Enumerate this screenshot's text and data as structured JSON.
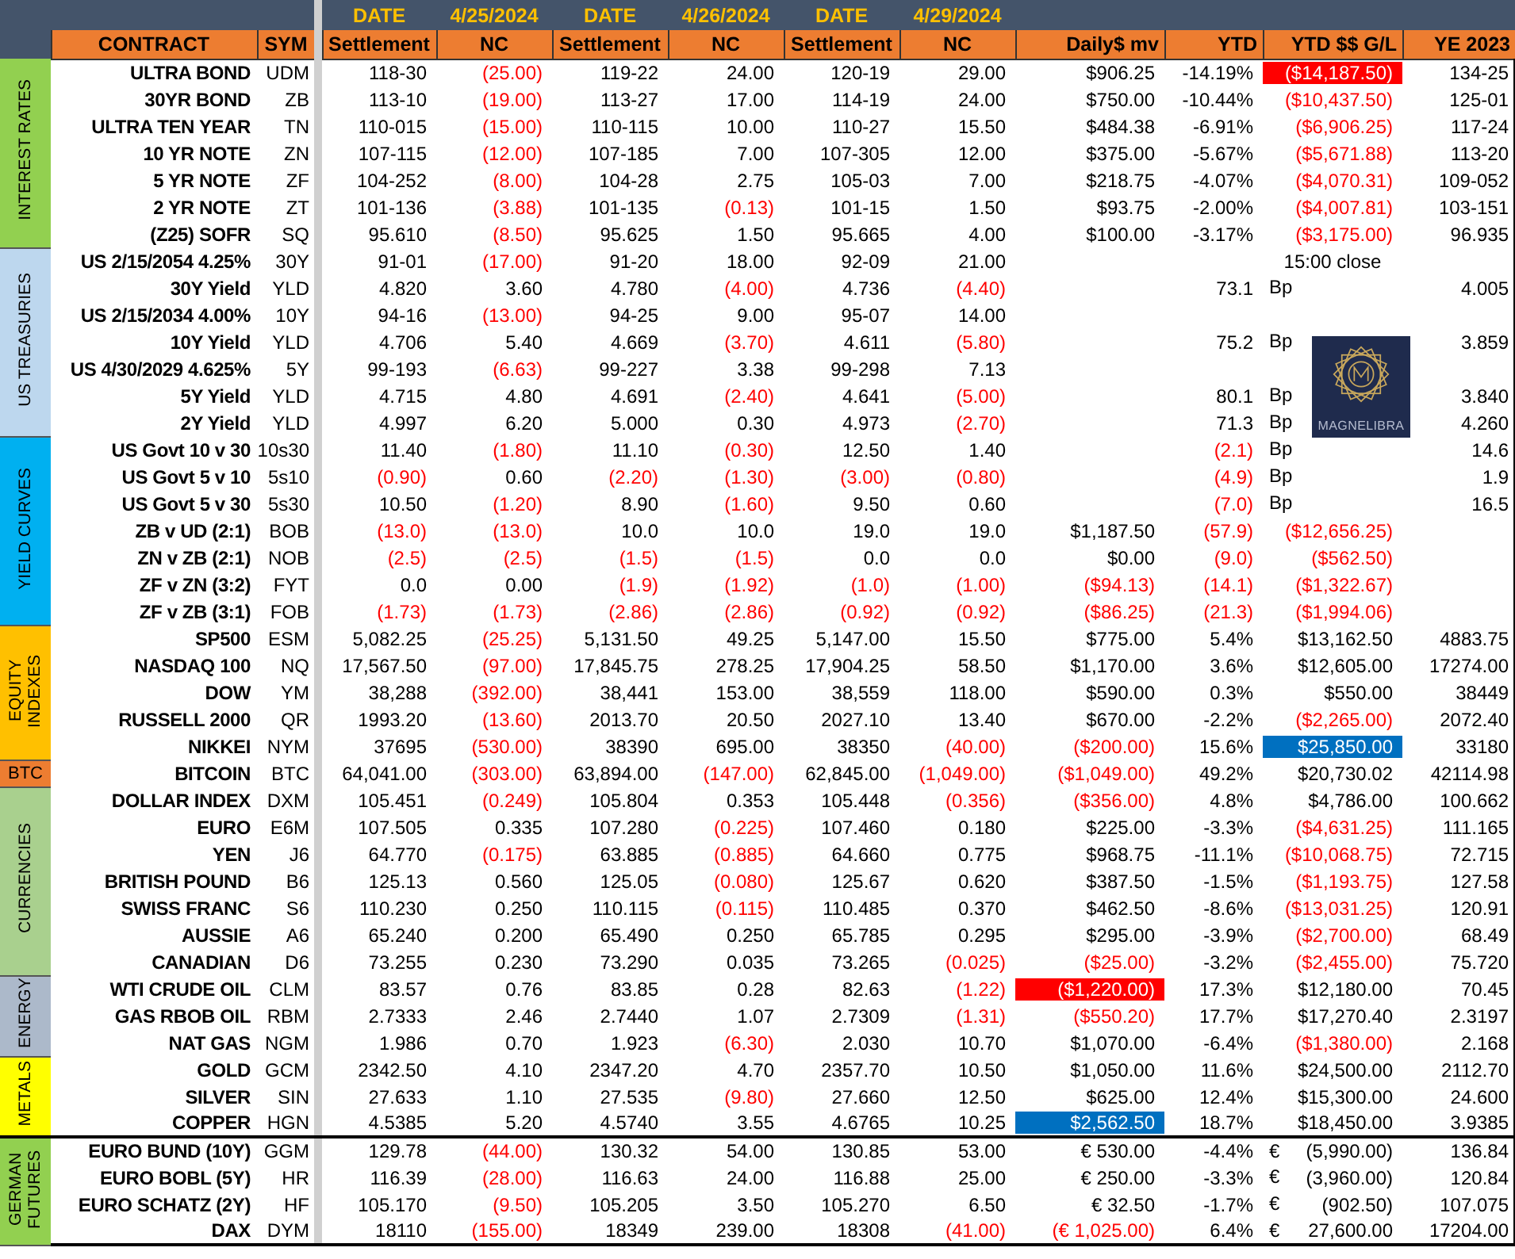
{
  "header": {
    "dates": [
      {
        "label": "DATE",
        "date": "4/25/2024"
      },
      {
        "label": "DATE",
        "date": "4/26/2024"
      },
      {
        "label": "DATE",
        "date": "4/29/2024"
      }
    ],
    "columns": [
      "CONTRACT",
      "SYM",
      "Settlement",
      "NC",
      "Settlement",
      "NC",
      "Settlement",
      "NC",
      "Daily$ mv",
      "YTD",
      "YTD $$ G/L",
      "YE 2023"
    ]
  },
  "logo": {
    "text": "MAGNELIBRA"
  },
  "sections": [
    {
      "label": "INTEREST RATES",
      "color": "#92d050",
      "rule_above": false,
      "rows": [
        {
          "name": "ULTRA BOND",
          "sym": "UDM",
          "s1": {
            "t": "118-30",
            "red": false
          },
          "nc1": {
            "t": "(25.00)",
            "red": true
          },
          "s2": {
            "t": "119-22",
            "red": false
          },
          "nc2": {
            "t": "24.00",
            "red": false
          },
          "s3": {
            "t": "120-19",
            "red": false
          },
          "nc3": {
            "t": "29.00",
            "red": false
          },
          "daily": {
            "t": "$906.25",
            "red": false
          },
          "ytd": {
            "t": "-14.19%",
            "red": false
          },
          "gl": {
            "t": "($14,187.50)",
            "color": "#ff0000"
          },
          "ye": "134-25"
        },
        {
          "name": "30YR BOND",
          "sym": "ZB",
          "s1": {
            "t": "113-10",
            "red": false
          },
          "nc1": {
            "t": "(19.00)",
            "red": true
          },
          "s2": {
            "t": "113-27",
            "red": false
          },
          "nc2": {
            "t": "17.00",
            "red": false
          },
          "s3": {
            "t": "114-19",
            "red": false
          },
          "nc3": {
            "t": "24.00",
            "red": false
          },
          "daily": {
            "t": "$750.00",
            "red": false
          },
          "ytd": {
            "t": "-10.44%",
            "red": false
          },
          "gl": {
            "t": "($10,437.50)",
            "red": true
          },
          "ye": "125-01"
        },
        {
          "name": "ULTRA TEN YEAR",
          "sym": "TN",
          "s1": {
            "t": "110-015",
            "red": false
          },
          "nc1": {
            "t": "(15.00)",
            "red": true
          },
          "s2": {
            "t": "110-115",
            "red": false
          },
          "nc2": {
            "t": "10.00",
            "red": false
          },
          "s3": {
            "t": "110-27",
            "red": false
          },
          "nc3": {
            "t": "15.50",
            "red": false
          },
          "daily": {
            "t": "$484.38",
            "red": false
          },
          "ytd": {
            "t": "-6.91%",
            "red": false
          },
          "gl": {
            "t": "($6,906.25)",
            "red": true
          },
          "ye": "117-24"
        },
        {
          "name": "10 YR NOTE",
          "sym": "ZN",
          "s1": {
            "t": "107-115",
            "red": false
          },
          "nc1": {
            "t": "(12.00)",
            "red": true
          },
          "s2": {
            "t": "107-185",
            "red": false
          },
          "nc2": {
            "t": "7.00",
            "red": false
          },
          "s3": {
            "t": "107-305",
            "red": false
          },
          "nc3": {
            "t": "12.00",
            "red": false
          },
          "daily": {
            "t": "$375.00",
            "red": false
          },
          "ytd": {
            "t": "-5.67%",
            "red": false
          },
          "gl": {
            "t": "($5,671.88)",
            "red": true
          },
          "ye": "113-20"
        },
        {
          "name": "5 YR NOTE",
          "sym": "ZF",
          "s1": {
            "t": "104-252",
            "red": false
          },
          "nc1": {
            "t": "(8.00)",
            "red": true
          },
          "s2": {
            "t": "104-28",
            "red": false
          },
          "nc2": {
            "t": "2.75",
            "red": false
          },
          "s3": {
            "t": "105-03",
            "red": false
          },
          "nc3": {
            "t": "7.00",
            "red": false
          },
          "daily": {
            "t": "$218.75",
            "red": false
          },
          "ytd": {
            "t": "-4.07%",
            "red": false
          },
          "gl": {
            "t": "($4,070.31)",
            "red": true
          },
          "ye": "109-052"
        },
        {
          "name": "2 YR NOTE",
          "sym": "ZT",
          "s1": {
            "t": "101-136",
            "red": false
          },
          "nc1": {
            "t": "(3.88)",
            "red": true
          },
          "s2": {
            "t": "101-135",
            "red": false
          },
          "nc2": {
            "t": "(0.13)",
            "red": true
          },
          "s3": {
            "t": "101-15",
            "red": false
          },
          "nc3": {
            "t": "1.50",
            "red": false
          },
          "daily": {
            "t": "$93.75",
            "red": false
          },
          "ytd": {
            "t": "-2.00%",
            "red": false
          },
          "gl": {
            "t": "($4,007.81)",
            "red": true
          },
          "ye": "103-151"
        },
        {
          "name": "(Z25) SOFR",
          "sym": "SQ",
          "s1": {
            "t": "95.610",
            "red": false
          },
          "nc1": {
            "t": "(8.50)",
            "red": true
          },
          "s2": {
            "t": "95.625",
            "red": false
          },
          "nc2": {
            "t": "1.50",
            "red": false
          },
          "s3": {
            "t": "95.665",
            "red": false
          },
          "nc3": {
            "t": "4.00",
            "red": false
          },
          "daily": {
            "t": "$100.00",
            "red": false
          },
          "ytd": {
            "t": "-3.17%",
            "red": false
          },
          "gl": {
            "t": "($3,175.00)",
            "red": true
          },
          "ye": "96.935"
        }
      ]
    },
    {
      "label": "US TREASURIES",
      "color": "#bdd7ee",
      "rule_above": false,
      "rows": [
        {
          "name": "US 2/15/2054 4.25%",
          "sym": "30Y",
          "s1": {
            "t": "91-01",
            "red": false
          },
          "nc1": {
            "t": "(17.00)",
            "red": true
          },
          "s2": {
            "t": "91-20",
            "red": false
          },
          "nc2": {
            "t": "18.00",
            "red": false
          },
          "s3": {
            "t": "92-09",
            "red": false
          },
          "nc3": {
            "t": "21.00",
            "red": false
          },
          "note": "15:00 close"
        },
        {
          "name": "30Y Yield",
          "sym": "YLD",
          "s1": {
            "t": "4.820",
            "red": false
          },
          "nc1": {
            "t": "3.60",
            "red": false
          },
          "s2": {
            "t": "4.780",
            "red": false
          },
          "nc2": {
            "t": "(4.00)",
            "red": true
          },
          "s3": {
            "t": "4.736",
            "red": false
          },
          "nc3": {
            "t": "(4.40)",
            "red": true
          },
          "ytd": {
            "t": "73.1",
            "red": false
          },
          "unit": "Bp",
          "ye": "4.005"
        },
        {
          "name": "US 2/15/2034 4.00%",
          "sym": "10Y",
          "s1": {
            "t": "94-16",
            "red": false
          },
          "nc1": {
            "t": "(13.00)",
            "red": true
          },
          "s2": {
            "t": "94-25",
            "red": false
          },
          "nc2": {
            "t": "9.00",
            "red": false
          },
          "s3": {
            "t": "95-07",
            "red": false
          },
          "nc3": {
            "t": "14.00",
            "red": false
          }
        },
        {
          "name": "10Y Yield",
          "sym": "YLD",
          "s1": {
            "t": "4.706",
            "red": false
          },
          "nc1": {
            "t": "5.40",
            "red": false
          },
          "s2": {
            "t": "4.669",
            "red": false
          },
          "nc2": {
            "t": "(3.70)",
            "red": true
          },
          "s3": {
            "t": "4.611",
            "red": false
          },
          "nc3": {
            "t": "(5.80)",
            "red": true
          },
          "ytd": {
            "t": "75.2",
            "red": false
          },
          "unit": "Bp",
          "ye": "3.859"
        },
        {
          "name": "US 4/30/2029 4.625%",
          "sym": "5Y",
          "s1": {
            "t": "99-193",
            "red": false
          },
          "nc1": {
            "t": "(6.63)",
            "red": true
          },
          "s2": {
            "t": "99-227",
            "red": false
          },
          "nc2": {
            "t": "3.38",
            "red": false
          },
          "s3": {
            "t": "99-298",
            "red": false
          },
          "nc3": {
            "t": "7.13",
            "red": false
          }
        },
        {
          "name": "5Y Yield",
          "sym": "YLD",
          "s1": {
            "t": "4.715",
            "red": false
          },
          "nc1": {
            "t": "4.80",
            "red": false
          },
          "s2": {
            "t": "4.691",
            "red": false
          },
          "nc2": {
            "t": "(2.40)",
            "red": true
          },
          "s3": {
            "t": "4.641",
            "red": false
          },
          "nc3": {
            "t": "(5.00)",
            "red": true
          },
          "ytd": {
            "t": "80.1",
            "red": false
          },
          "unit": "Bp",
          "ye": "3.840"
        },
        {
          "name": "2Y Yield",
          "sym": "YLD",
          "s1": {
            "t": "4.997",
            "red": false
          },
          "nc1": {
            "t": "6.20",
            "red": false
          },
          "s2": {
            "t": "5.000",
            "red": false
          },
          "nc2": {
            "t": "0.30",
            "red": false
          },
          "s3": {
            "t": "4.973",
            "red": false
          },
          "nc3": {
            "t": "(2.70)",
            "red": true
          },
          "ytd": {
            "t": "71.3",
            "red": false
          },
          "unit": "Bp",
          "ye": "4.260"
        }
      ]
    },
    {
      "label": "YIELD CURVES",
      "color": "#00b0f0",
      "rule_above": false,
      "rows": [
        {
          "name": "US Govt 10 v 30",
          "sym": "10s30",
          "s1": {
            "t": "11.40",
            "red": false
          },
          "nc1": {
            "t": "(1.80)",
            "red": true
          },
          "s2": {
            "t": "11.10",
            "red": false
          },
          "nc2": {
            "t": "(0.30)",
            "red": true
          },
          "s3": {
            "t": "12.50",
            "red": false
          },
          "nc3": {
            "t": "1.40",
            "red": false
          },
          "ytd": {
            "t": "(2.1)",
            "red": true
          },
          "unit": "Bp",
          "ye": "14.6"
        },
        {
          "name": "US Govt 5 v 10",
          "sym": "5s10",
          "s1": {
            "t": "(0.90)",
            "red": true
          },
          "nc1": {
            "t": "0.60",
            "red": false
          },
          "s2": {
            "t": "(2.20)",
            "red": true
          },
          "nc2": {
            "t": "(1.30)",
            "red": true
          },
          "s3": {
            "t": "(3.00)",
            "red": true
          },
          "nc3": {
            "t": "(0.80)",
            "red": true
          },
          "ytd": {
            "t": "(4.9)",
            "red": true
          },
          "unit": "Bp",
          "ye": "1.9"
        },
        {
          "name": "US Govt 5 v 30",
          "sym": "5s30",
          "s1": {
            "t": "10.50",
            "red": false
          },
          "nc1": {
            "t": "(1.20)",
            "red": true
          },
          "s2": {
            "t": "8.90",
            "red": false
          },
          "nc2": {
            "t": "(1.60)",
            "red": true
          },
          "s3": {
            "t": "9.50",
            "red": false
          },
          "nc3": {
            "t": "0.60",
            "red": false
          },
          "ytd": {
            "t": "(7.0)",
            "red": true
          },
          "unit": "Bp",
          "ye": "16.5"
        },
        {
          "name": "ZB v UD (2:1)",
          "sym": "BOB",
          "s1": {
            "t": "(13.0)",
            "red": true
          },
          "nc1": {
            "t": "(13.0)",
            "red": true
          },
          "s2": {
            "t": "10.0",
            "red": false
          },
          "nc2": {
            "t": "10.0",
            "red": false
          },
          "s3": {
            "t": "19.0",
            "red": false
          },
          "nc3": {
            "t": "19.0",
            "red": false
          },
          "daily": {
            "t": "$1,187.50",
            "red": false
          },
          "ytd": {
            "t": "(57.9)",
            "red": true
          },
          "gl": {
            "t": "($12,656.25)",
            "red": true
          }
        },
        {
          "name": "ZN v ZB (2:1)",
          "sym": "NOB",
          "s1": {
            "t": "(2.5)",
            "red": true
          },
          "nc1": {
            "t": "(2.5)",
            "red": true
          },
          "s2": {
            "t": "(1.5)",
            "red": true
          },
          "nc2": {
            "t": "(1.5)",
            "red": true
          },
          "s3": {
            "t": "0.0",
            "red": false
          },
          "nc3": {
            "t": "0.0",
            "red": false
          },
          "daily": {
            "t": "$0.00",
            "red": false
          },
          "ytd": {
            "t": "(9.0)",
            "red": true
          },
          "gl": {
            "t": "($562.50)",
            "red": true
          }
        },
        {
          "name": "ZF v ZN (3:2)",
          "sym": "FYT",
          "s1": {
            "t": "0.0",
            "red": false
          },
          "nc1": {
            "t": "0.00",
            "red": false
          },
          "s2": {
            "t": "(1.9)",
            "red": true
          },
          "nc2": {
            "t": "(1.92)",
            "red": true
          },
          "s3": {
            "t": "(1.0)",
            "red": true
          },
          "nc3": {
            "t": "(1.00)",
            "red": true
          },
          "daily": {
            "t": "($94.13)",
            "red": true
          },
          "ytd": {
            "t": "(14.1)",
            "red": true
          },
          "gl": {
            "t": "($1,322.67)",
            "red": true
          }
        },
        {
          "name": "ZF v ZB (3:1)",
          "sym": "FOB",
          "s1": {
            "t": "(1.73)",
            "red": true
          },
          "nc1": {
            "t": "(1.73)",
            "red": true
          },
          "s2": {
            "t": "(2.86)",
            "red": true
          },
          "nc2": {
            "t": "(2.86)",
            "red": true
          },
          "s3": {
            "t": "(0.92)",
            "red": true
          },
          "nc3": {
            "t": "(0.92)",
            "red": true
          },
          "daily": {
            "t": "($86.25)",
            "red": true
          },
          "ytd": {
            "t": "(21.3)",
            "red": true
          },
          "gl": {
            "t": "($1,994.06)",
            "red": true
          }
        }
      ]
    },
    {
      "label": "EQUITY INDEXES",
      "color": "#ffc000",
      "rule_above": false,
      "rows": [
        {
          "name": "SP500",
          "sym": "ESM",
          "s1": {
            "t": "5,082.25",
            "red": false
          },
          "nc1": {
            "t": "(25.25)",
            "red": true
          },
          "s2": {
            "t": "5,131.50",
            "red": false
          },
          "nc2": {
            "t": "49.25",
            "red": false
          },
          "s3": {
            "t": "5,147.00",
            "red": false
          },
          "nc3": {
            "t": "15.50",
            "red": false
          },
          "daily": {
            "t": "$775.00",
            "red": false
          },
          "ytd": {
            "t": "5.4%",
            "red": false
          },
          "gl": {
            "t": "$13,162.50",
            "red": false
          },
          "ye": "4883.75"
        },
        {
          "name": "NASDAQ 100",
          "sym": "NQ",
          "s1": {
            "t": "17,567.50",
            "red": false
          },
          "nc1": {
            "t": "(97.00)",
            "red": true
          },
          "s2": {
            "t": "17,845.75",
            "red": false
          },
          "nc2": {
            "t": "278.25",
            "red": false
          },
          "s3": {
            "t": "17,904.25",
            "red": false
          },
          "nc3": {
            "t": "58.50",
            "red": false
          },
          "daily": {
            "t": "$1,170.00",
            "red": false
          },
          "ytd": {
            "t": "3.6%",
            "red": false
          },
          "gl": {
            "t": "$12,605.00",
            "red": false
          },
          "ye": "17274.00"
        },
        {
          "name": "DOW",
          "sym": "YM",
          "s1": {
            "t": "38,288",
            "red": false
          },
          "nc1": {
            "t": "(392.00)",
            "red": true
          },
          "s2": {
            "t": "38,441",
            "red": false
          },
          "nc2": {
            "t": "153.00",
            "red": false
          },
          "s3": {
            "t": "38,559",
            "red": false
          },
          "nc3": {
            "t": "118.00",
            "red": false
          },
          "daily": {
            "t": "$590.00",
            "red": false
          },
          "ytd": {
            "t": "0.3%",
            "red": false
          },
          "gl": {
            "t": "$550.00",
            "red": false
          },
          "ye": "38449"
        },
        {
          "name": "RUSSELL 2000",
          "sym": "QR",
          "s1": {
            "t": "1993.20",
            "red": false
          },
          "nc1": {
            "t": "(13.60)",
            "red": true
          },
          "s2": {
            "t": "2013.70",
            "red": false
          },
          "nc2": {
            "t": "20.50",
            "red": false
          },
          "s3": {
            "t": "2027.10",
            "red": false
          },
          "nc3": {
            "t": "13.40",
            "red": false
          },
          "daily": {
            "t": "$670.00",
            "red": false
          },
          "ytd": {
            "t": "-2.2%",
            "red": false
          },
          "gl": {
            "t": "($2,265.00)",
            "red": true
          },
          "ye": "2072.40"
        },
        {
          "name": "NIKKEI",
          "sym": "NYM",
          "s1": {
            "t": "37695",
            "red": false
          },
          "nc1": {
            "t": "(530.00)",
            "red": true
          },
          "s2": {
            "t": "38390",
            "red": false
          },
          "nc2": {
            "t": "695.00",
            "red": false
          },
          "s3": {
            "t": "38350",
            "red": false
          },
          "nc3": {
            "t": "(40.00)",
            "red": true
          },
          "daily": {
            "t": "($200.00)",
            "red": true
          },
          "ytd": {
            "t": "15.6%",
            "red": false
          },
          "gl": {
            "t": "$25,850.00",
            "color": "#0070c0"
          },
          "ye": "33180"
        }
      ]
    },
    {
      "label": "BTC",
      "color": "#ed7d31",
      "rule_above": false,
      "rows": [
        {
          "name": "BITCOIN",
          "sym": "BTC",
          "s1": {
            "t": "64,041.00",
            "red": false
          },
          "nc1": {
            "t": "(303.00)",
            "red": true
          },
          "s2": {
            "t": "63,894.00",
            "red": false
          },
          "nc2": {
            "t": "(147.00)",
            "red": true
          },
          "s3": {
            "t": "62,845.00",
            "red": false
          },
          "nc3": {
            "t": "(1,049.00)",
            "red": true
          },
          "daily": {
            "t": "($1,049.00)",
            "red": true
          },
          "ytd": {
            "t": "49.2%",
            "red": false
          },
          "gl": {
            "t": "$20,730.02",
            "red": false
          },
          "ye": "42114.98"
        }
      ]
    },
    {
      "label": "CURRENCIES",
      "color": "#a9d08e",
      "rule_above": false,
      "rows": [
        {
          "name": "DOLLAR INDEX",
          "sym": "DXM",
          "s1": {
            "t": "105.451",
            "red": false
          },
          "nc1": {
            "t": "(0.249)",
            "red": true
          },
          "s2": {
            "t": "105.804",
            "red": false
          },
          "nc2": {
            "t": "0.353",
            "red": false
          },
          "s3": {
            "t": "105.448",
            "red": false
          },
          "nc3": {
            "t": "(0.356)",
            "red": true
          },
          "daily": {
            "t": "($356.00)",
            "red": true
          },
          "ytd": {
            "t": "4.8%",
            "red": false
          },
          "gl": {
            "t": "$4,786.00",
            "red": false
          },
          "ye": "100.662"
        },
        {
          "name": "EURO",
          "sym": "E6M",
          "s1": {
            "t": "107.505",
            "red": false
          },
          "nc1": {
            "t": "0.335",
            "red": false
          },
          "s2": {
            "t": "107.280",
            "red": false
          },
          "nc2": {
            "t": "(0.225)",
            "red": true
          },
          "s3": {
            "t": "107.460",
            "red": false
          },
          "nc3": {
            "t": "0.180",
            "red": false
          },
          "daily": {
            "t": "$225.00",
            "red": false
          },
          "ytd": {
            "t": "-3.3%",
            "red": false
          },
          "gl": {
            "t": "($4,631.25)",
            "red": true
          },
          "ye": "111.165"
        },
        {
          "name": "YEN",
          "sym": "J6",
          "s1": {
            "t": "64.770",
            "red": false
          },
          "nc1": {
            "t": "(0.175)",
            "red": true
          },
          "s2": {
            "t": "63.885",
            "red": false
          },
          "nc2": {
            "t": "(0.885)",
            "red": true
          },
          "s3": {
            "t": "64.660",
            "red": false
          },
          "nc3": {
            "t": "0.775",
            "red": false
          },
          "daily": {
            "t": "$968.75",
            "red": false
          },
          "ytd": {
            "t": "-11.1%",
            "red": false
          },
          "gl": {
            "t": "($10,068.75)",
            "red": true
          },
          "ye": "72.715"
        },
        {
          "name": "BRITISH POUND",
          "sym": "B6",
          "s1": {
            "t": "125.13",
            "red": false
          },
          "nc1": {
            "t": "0.560",
            "red": false
          },
          "s2": {
            "t": "125.05",
            "red": false
          },
          "nc2": {
            "t": "(0.080)",
            "red": true
          },
          "s3": {
            "t": "125.67",
            "red": false
          },
          "nc3": {
            "t": "0.620",
            "red": false
          },
          "daily": {
            "t": "$387.50",
            "red": false
          },
          "ytd": {
            "t": "-1.5%",
            "red": false
          },
          "gl": {
            "t": "($1,193.75)",
            "red": true
          },
          "ye": "127.58"
        },
        {
          "name": "SWISS FRANC",
          "sym": "S6",
          "s1": {
            "t": "110.230",
            "red": false
          },
          "nc1": {
            "t": "0.250",
            "red": false
          },
          "s2": {
            "t": "110.115",
            "red": false
          },
          "nc2": {
            "t": "(0.115)",
            "red": true
          },
          "s3": {
            "t": "110.485",
            "red": false
          },
          "nc3": {
            "t": "0.370",
            "red": false
          },
          "daily": {
            "t": "$462.50",
            "red": false
          },
          "ytd": {
            "t": "-8.6%",
            "red": false
          },
          "gl": {
            "t": "($13,031.25)",
            "red": true
          },
          "ye": "120.91"
        },
        {
          "name": "AUSSIE",
          "sym": "A6",
          "s1": {
            "t": "65.240",
            "red": false
          },
          "nc1": {
            "t": "0.200",
            "red": false
          },
          "s2": {
            "t": "65.490",
            "red": false
          },
          "nc2": {
            "t": "0.250",
            "red": false
          },
          "s3": {
            "t": "65.785",
            "red": false
          },
          "nc3": {
            "t": "0.295",
            "red": false
          },
          "daily": {
            "t": "$295.00",
            "red": false
          },
          "ytd": {
            "t": "-3.9%",
            "red": false
          },
          "gl": {
            "t": "($2,700.00)",
            "red": true
          },
          "ye": "68.49"
        },
        {
          "name": "CANADIAN",
          "sym": "D6",
          "s1": {
            "t": "73.255",
            "red": false
          },
          "nc1": {
            "t": "0.230",
            "red": false
          },
          "s2": {
            "t": "73.290",
            "red": false
          },
          "nc2": {
            "t": "0.035",
            "red": false
          },
          "s3": {
            "t": "73.265",
            "red": false
          },
          "nc3": {
            "t": "(0.025)",
            "red": true
          },
          "daily": {
            "t": "($25.00)",
            "red": true
          },
          "ytd": {
            "t": "-3.2%",
            "red": false
          },
          "gl": {
            "t": "($2,455.00)",
            "red": true
          },
          "ye": "75.720"
        }
      ]
    },
    {
      "label": "ENERGY",
      "color": "#acb9ca",
      "rule_above": false,
      "rows": [
        {
          "name": "WTI CRUDE OIL",
          "sym": "CLM",
          "s1": {
            "t": "83.57",
            "red": false
          },
          "nc1": {
            "t": "0.76",
            "red": false
          },
          "s2": {
            "t": "83.85",
            "red": false
          },
          "nc2": {
            "t": "0.28",
            "red": false
          },
          "s3": {
            "t": "82.63",
            "red": false
          },
          "nc3": {
            "t": "(1.22)",
            "red": true
          },
          "daily": {
            "t": "($1,220.00)",
            "color": "#ff0000"
          },
          "ytd": {
            "t": "17.3%",
            "red": false
          },
          "gl": {
            "t": "$12,180.00",
            "red": false
          },
          "ye": "70.45"
        },
        {
          "name": "GAS RBOB OIL",
          "sym": "RBM",
          "s1": {
            "t": "2.7333",
            "red": false
          },
          "nc1": {
            "t": "2.46",
            "red": false
          },
          "s2": {
            "t": "2.7440",
            "red": false
          },
          "nc2": {
            "t": "1.07",
            "red": false
          },
          "s3": {
            "t": "2.7309",
            "red": false
          },
          "nc3": {
            "t": "(1.31)",
            "red": true
          },
          "daily": {
            "t": "($550.20)",
            "red": true
          },
          "ytd": {
            "t": "17.7%",
            "red": false
          },
          "gl": {
            "t": "$17,270.40",
            "red": false
          },
          "ye": "2.3197"
        },
        {
          "name": "NAT GAS",
          "sym": "NGM",
          "s1": {
            "t": "1.986",
            "red": false
          },
          "nc1": {
            "t": "0.70",
            "red": false
          },
          "s2": {
            "t": "1.923",
            "red": false
          },
          "nc2": {
            "t": "(6.30)",
            "red": true
          },
          "s3": {
            "t": "2.030",
            "red": false
          },
          "nc3": {
            "t": "10.70",
            "red": false
          },
          "daily": {
            "t": "$1,070.00",
            "red": false
          },
          "ytd": {
            "t": "-6.4%",
            "red": false
          },
          "gl": {
            "t": "($1,380.00)",
            "red": true
          },
          "ye": "2.168"
        }
      ]
    },
    {
      "label": "METALS",
      "color": "#ffff00",
      "rule_above": false,
      "rows": [
        {
          "name": "GOLD",
          "sym": "GCM",
          "s1": {
            "t": "2342.50",
            "red": false
          },
          "nc1": {
            "t": "4.10",
            "red": false
          },
          "s2": {
            "t": "2347.20",
            "red": false
          },
          "nc2": {
            "t": "4.70",
            "red": false
          },
          "s3": {
            "t": "2357.70",
            "red": false
          },
          "nc3": {
            "t": "10.50",
            "red": false
          },
          "daily": {
            "t": "$1,050.00",
            "red": false
          },
          "ytd": {
            "t": "11.6%",
            "red": false
          },
          "gl": {
            "t": "$24,500.00",
            "red": false
          },
          "ye": "2112.70"
        },
        {
          "name": "SILVER",
          "sym": "SIN",
          "s1": {
            "t": "27.633",
            "red": false
          },
          "nc1": {
            "t": "1.10",
            "red": false
          },
          "s2": {
            "t": "27.535",
            "red": false
          },
          "nc2": {
            "t": "(9.80)",
            "red": true
          },
          "s3": {
            "t": "27.660",
            "red": false
          },
          "nc3": {
            "t": "12.50",
            "red": false
          },
          "daily": {
            "t": "$625.00",
            "red": false
          },
          "ytd": {
            "t": "12.4%",
            "red": false
          },
          "gl": {
            "t": "$15,300.00",
            "red": false
          },
          "ye": "24.600"
        },
        {
          "name": "COPPER",
          "sym": "HGN",
          "s1": {
            "t": "4.5385",
            "red": false
          },
          "nc1": {
            "t": "5.20",
            "red": false
          },
          "s2": {
            "t": "4.5740",
            "red": false
          },
          "nc2": {
            "t": "3.55",
            "red": false
          },
          "s3": {
            "t": "4.6765",
            "red": false
          },
          "nc3": {
            "t": "10.25",
            "red": false
          },
          "daily": {
            "t": "$2,562.50",
            "color": "#0070c0"
          },
          "ytd": {
            "t": "18.7%",
            "red": false
          },
          "gl": {
            "t": "$18,450.00",
            "red": false
          },
          "ye": "3.9385"
        }
      ]
    },
    {
      "label": "GERMAN FUTURES",
      "color": "#92d050",
      "rule_above": true,
      "rows": [
        {
          "name": "EURO BUND (10Y)",
          "sym": "GGM",
          "s1": {
            "t": "129.78",
            "red": false
          },
          "nc1": {
            "t": "(44.00)",
            "red": true
          },
          "s2": {
            "t": "130.32",
            "red": false
          },
          "nc2": {
            "t": "54.00",
            "red": false
          },
          "s3": {
            "t": "130.85",
            "red": false
          },
          "nc3": {
            "t": "53.00",
            "red": false
          },
          "daily": {
            "t": "€ 530.00",
            "red": false
          },
          "ytd": {
            "t": "-4.4%",
            "red": false
          },
          "gl_currency": "€",
          "gl": {
            "t": "(5,990.00)",
            "red": false
          },
          "ye": "136.84"
        },
        {
          "name": "EURO BOBL (5Y)",
          "sym": "HR",
          "s1": {
            "t": "116.39",
            "red": false
          },
          "nc1": {
            "t": "(28.00)",
            "red": true
          },
          "s2": {
            "t": "116.63",
            "red": false
          },
          "nc2": {
            "t": "24.00",
            "red": false
          },
          "s3": {
            "t": "116.88",
            "red": false
          },
          "nc3": {
            "t": "25.00",
            "red": false
          },
          "daily": {
            "t": "€ 250.00",
            "red": false
          },
          "ytd": {
            "t": "-3.3%",
            "red": false
          },
          "gl_currency": "€",
          "gl": {
            "t": "(3,960.00)",
            "red": false
          },
          "ye": "120.84"
        },
        {
          "name": "EURO SCHATZ (2Y)",
          "sym": "HF",
          "s1": {
            "t": "105.170",
            "red": false
          },
          "nc1": {
            "t": "(9.50)",
            "red": true
          },
          "s2": {
            "t": "105.205",
            "red": false
          },
          "nc2": {
            "t": "3.50",
            "red": false
          },
          "s3": {
            "t": "105.270",
            "red": false
          },
          "nc3": {
            "t": "6.50",
            "red": false
          },
          "daily": {
            "t": "€ 32.50",
            "red": false
          },
          "ytd": {
            "t": "-1.7%",
            "red": false
          },
          "gl_currency": "€",
          "gl": {
            "t": "(902.50)",
            "red": false
          },
          "ye": "107.075"
        },
        {
          "name": "DAX",
          "sym": "DYM",
          "s1": {
            "t": "18110",
            "red": false
          },
          "nc1": {
            "t": "(155.00)",
            "red": true
          },
          "s2": {
            "t": "18349",
            "red": false
          },
          "nc2": {
            "t": "239.00",
            "red": false
          },
          "s3": {
            "t": "18308",
            "red": false
          },
          "nc3": {
            "t": "(41.00)",
            "red": true
          },
          "daily": {
            "t": "(€ 1,025.00)",
            "red": true
          },
          "ytd": {
            "t": "6.4%",
            "red": false
          },
          "gl_currency": "€",
          "gl": {
            "t": "27,600.00",
            "red": false
          },
          "ye": "17204.00"
        }
      ]
    }
  ]
}
